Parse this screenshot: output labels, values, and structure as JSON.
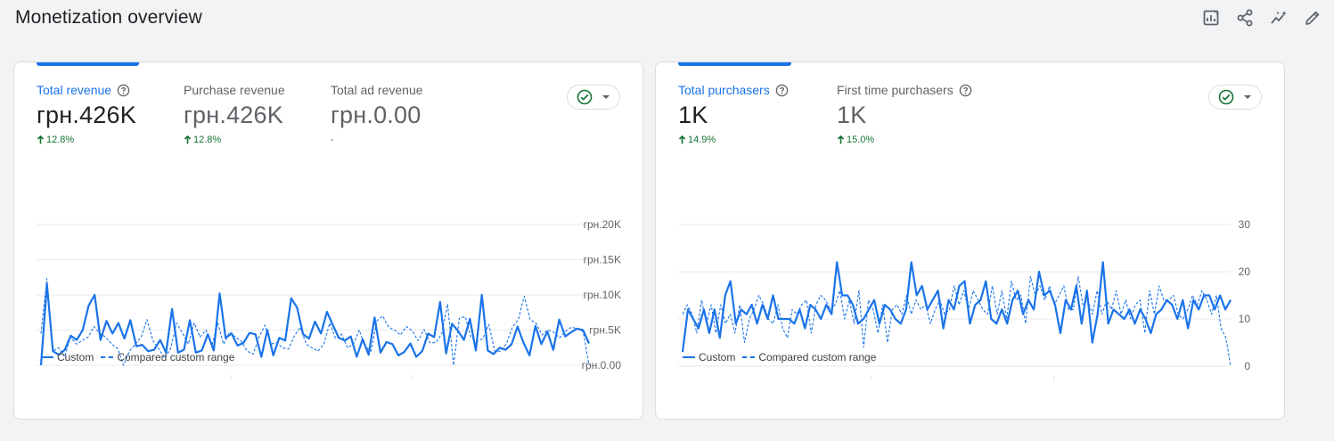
{
  "header": {
    "title": "Monetization overview",
    "icons": [
      "edit-report-icon",
      "share-icon",
      "insights-icon",
      "pencil-icon"
    ]
  },
  "colors": {
    "accent": "#1a73e8",
    "positive": "#137333",
    "muted": "#5f6368"
  },
  "cards": [
    {
      "metrics": [
        {
          "label": "Total revenue",
          "value": "грн.426K",
          "change": "12.8%",
          "direction": "up",
          "active": true,
          "help": true
        },
        {
          "label": "Purchase revenue",
          "value": "грн.426K",
          "change": "12.8%",
          "direction": "up",
          "active": false,
          "help": false
        },
        {
          "label": "Total ad revenue",
          "value": "грн.0.00",
          "change": "-",
          "direction": "none",
          "active": false,
          "help": false
        }
      ],
      "legend": {
        "current": "Custom",
        "compared": "Compared custom range"
      }
    },
    {
      "metrics": [
        {
          "label": "Total purchasers",
          "value": "1K",
          "change": "14.9%",
          "direction": "up",
          "active": true,
          "help": true
        },
        {
          "label": "First time purchasers",
          "value": "1K",
          "change": "15.0%",
          "direction": "up",
          "active": false,
          "help": true
        }
      ],
      "legend": {
        "current": "Custom",
        "compared": "Compared custom range"
      }
    }
  ],
  "chart_data": [
    {
      "type": "line",
      "title": "Total revenue",
      "ylim": [
        0,
        20000
      ],
      "yticks": [
        "грн.0.00",
        "грн.5K",
        "грн.10K",
        "грн.15K",
        "грн.20K"
      ],
      "ytick_values": [
        0,
        5000,
        10000,
        15000,
        20000
      ],
      "grid": true,
      "legend_position": "bottom-left",
      "series": [
        {
          "name": "Custom",
          "style": "solid",
          "values": [
            0,
            11500,
            2000,
            1500,
            2200,
            4200,
            3600,
            5000,
            8500,
            10000,
            3600,
            6300,
            4500,
            6000,
            3800,
            6400,
            2700,
            2900,
            2000,
            2200,
            3600,
            1800,
            8000,
            1800,
            2200,
            6400,
            1800,
            2100,
            4400,
            2100,
            10200,
            3900,
            4500,
            2800,
            3200,
            4600,
            4400,
            1200,
            5000,
            1400,
            3900,
            3500,
            9500,
            8200,
            4400,
            3800,
            6200,
            4500,
            7600,
            5700,
            3900,
            3500,
            4100,
            1200,
            3700,
            1500,
            6800,
            1800,
            3300,
            3000,
            1400,
            1900,
            3100,
            1200,
            2000,
            4500,
            4000,
            9000,
            1700,
            5900,
            4900,
            3600,
            6600,
            2100,
            10000,
            2100,
            1600,
            2500,
            2200,
            3000,
            5500,
            3200,
            1400,
            5600,
            3000,
            4800,
            2200,
            6500,
            4100,
            4700,
            5200,
            5000,
            3100
          ]
        },
        {
          "name": "Compared custom range",
          "style": "dashed",
          "values": [
            4500,
            12300,
            2000,
            2500,
            1200,
            4000,
            3000,
            3500,
            4000,
            5500,
            4500,
            4000,
            3000,
            2400,
            0,
            2000,
            3000,
            4000,
            6500,
            3500,
            2300,
            1000,
            2400,
            6000,
            4600,
            3000,
            6000,
            4000,
            5000,
            2800,
            6000,
            3000,
            4700,
            4000,
            3400,
            2000,
            1600,
            4000,
            5700,
            3000,
            3200,
            2500,
            2300,
            4200,
            5400,
            3000,
            2500,
            2000,
            3000,
            6000,
            3800,
            4400,
            2500,
            3000,
            5000,
            2700,
            2000,
            6300,
            7000,
            5400,
            5000,
            4300,
            5500,
            4900,
            3500,
            5100,
            3200,
            3200,
            4500,
            8700,
            0,
            6700,
            6900,
            3900,
            3400,
            3800,
            5800,
            2000,
            2000,
            3100,
            5400,
            6500,
            9800,
            6500,
            6000,
            4300,
            5000,
            4700,
            3900,
            4800,
            5400,
            5200,
            4800,
            0
          ]
        }
      ]
    },
    {
      "type": "line",
      "title": "Total purchasers",
      "ylim": [
        0,
        30
      ],
      "yticks": [
        "0",
        "10",
        "20",
        "30"
      ],
      "ytick_values": [
        0,
        10,
        20,
        30
      ],
      "grid": true,
      "legend_position": "bottom-left",
      "series": [
        {
          "name": "Custom",
          "style": "solid",
          "values": [
            3,
            12,
            10,
            8,
            12,
            7,
            12,
            6,
            15,
            18,
            9,
            12,
            11,
            13,
            9,
            13,
            10,
            15,
            10,
            10,
            10,
            9,
            12,
            8,
            13,
            12,
            10,
            13,
            11,
            22,
            15,
            15,
            13,
            9,
            10,
            12,
            14,
            9,
            13,
            12,
            10,
            9,
            12,
            22,
            15,
            17,
            12,
            14,
            16,
            8,
            14,
            12,
            17,
            18,
            9,
            13,
            14,
            18,
            10,
            9,
            12,
            9,
            14,
            16,
            11,
            14,
            12,
            20,
            15,
            16,
            13,
            7,
            14,
            12,
            17,
            9,
            16,
            5,
            11,
            22,
            9,
            12,
            11,
            10,
            12,
            9,
            12,
            10,
            7,
            11,
            12,
            14,
            13,
            10,
            14,
            8,
            14,
            12,
            15,
            15,
            12,
            15,
            12,
            14
          ]
        },
        {
          "name": "Compared custom range",
          "style": "dashed",
          "values": [
            11,
            13,
            11,
            7,
            14,
            9,
            13,
            7,
            13,
            9,
            11,
            7,
            13,
            5,
            10,
            12,
            15,
            13,
            10,
            9,
            13,
            8,
            6,
            12,
            11,
            13,
            14,
            7,
            13,
            15,
            14,
            12,
            13,
            16,
            10,
            14,
            9,
            16,
            4,
            14,
            12,
            7,
            13,
            5,
            12,
            13,
            11,
            15,
            11,
            14,
            12,
            13,
            9,
            12,
            14,
            11,
            12,
            17,
            13,
            16,
            12,
            16,
            14,
            12,
            11,
            17,
            11,
            16,
            10,
            18,
            14,
            15,
            9,
            19,
            15,
            17,
            14,
            17,
            13,
            15,
            17,
            12,
            12,
            19,
            13,
            14,
            11,
            16,
            11,
            14,
            12,
            16,
            11,
            14,
            10,
            13,
            14,
            7,
            16,
            11,
            17,
            14,
            14,
            15,
            11,
            10,
            12,
            15,
            13,
            16,
            14,
            11,
            15,
            8,
            6,
            0
          ]
        }
      ]
    }
  ]
}
